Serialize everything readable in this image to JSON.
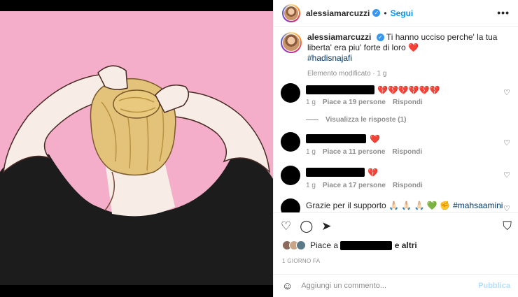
{
  "post": {
    "username": "alessiamarcuzzi",
    "follow_label": "Segui",
    "more_label": "•••",
    "separator": "•"
  },
  "caption": {
    "username": "alessiamarcuzzi",
    "text": "Ti hanno ucciso perche' la tua liberta' era piu' forte di loro",
    "emoji": "❤️",
    "hashtag": "#hadisnajafi",
    "meta": "Elemento modificato · 1 g"
  },
  "comments": [
    {
      "emoji": "💔💔💔💔💔💔",
      "age": "1 g",
      "likes": "Piace a 19 persone",
      "reply": "Rispondi"
    },
    {
      "emoji": "❤️",
      "age": "1 g",
      "likes": "Piace a 11 persone",
      "reply": "Rispondi"
    },
    {
      "emoji": "💔",
      "age": "1 g",
      "likes": "Piace a 17 persone",
      "reply": "Rispondi"
    },
    {
      "text": "Grazie per il supporto 🙏🏻 🙏🏻 🙏🏻 💚 ✊",
      "hashtag": "#mahsaamini"
    }
  ],
  "view_replies": "Visualizza le risposte (1)",
  "actions": {
    "like_icon": "heart-icon",
    "comment_icon": "comment-icon",
    "share_icon": "share-icon",
    "save_icon": "bookmark-icon"
  },
  "likes": {
    "prefix": "Piace a",
    "suffix": "e altri"
  },
  "time_ago": "1 GIORNO FA",
  "add_comment": {
    "placeholder": "Aggiungi un commento...",
    "publish": "Pubblica"
  },
  "colors": {
    "accent": "#0095f6",
    "pink_bg": "#f4aec9",
    "hair": "#e3c27a",
    "shirt": "#1c1c1c"
  }
}
